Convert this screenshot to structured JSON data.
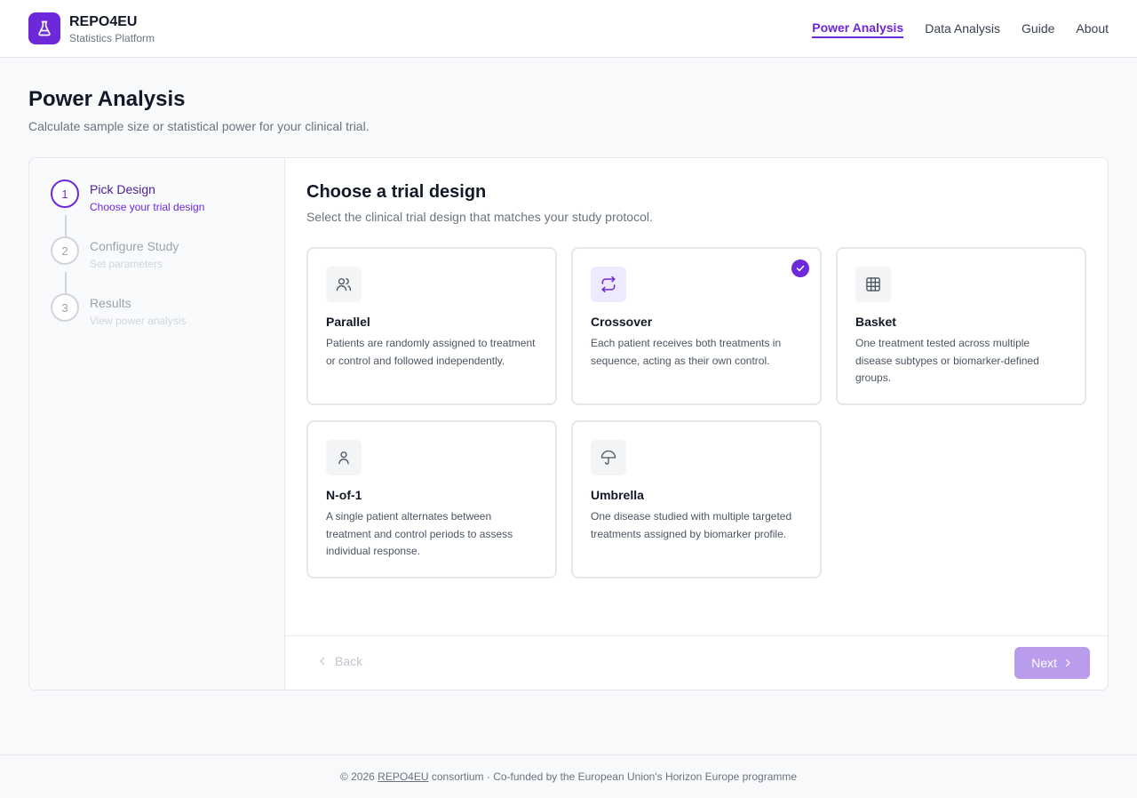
{
  "brand": {
    "name": "REPO4EU",
    "subtitle": "Statistics Platform"
  },
  "nav": [
    {
      "label": "Power Analysis",
      "active": true
    },
    {
      "label": "Data Analysis"
    },
    {
      "label": "Guide"
    },
    {
      "label": "About"
    }
  ],
  "page": {
    "title": "Power Analysis",
    "subtitle": "Calculate sample size or statistical power for your clinical trial."
  },
  "steps": [
    {
      "number": "1",
      "title": "Pick Design",
      "desc": "Choose your trial design",
      "state": "active"
    },
    {
      "number": "2",
      "title": "Configure Study",
      "desc": "Set parameters",
      "state": "pending"
    },
    {
      "number": "3",
      "title": "Results",
      "desc": "View power analysis",
      "state": "pending"
    }
  ],
  "content": {
    "title": "Choose a trial design",
    "subtitle": "Select the clinical trial design that matches your study protocol."
  },
  "designs": [
    {
      "id": "parallel",
      "icon": "users-icon",
      "title": "Parallel",
      "desc": "Patients are randomly assigned to treatment or control and followed independently."
    },
    {
      "id": "crossover",
      "icon": "repeat-icon",
      "title": "Crossover",
      "desc": "Each patient receives both treatments in sequence, acting as their own control.",
      "selected": true
    },
    {
      "id": "basket",
      "icon": "grid-icon",
      "title": "Basket",
      "desc": "One treatment tested across multiple disease subtypes or biomarker-defined groups."
    },
    {
      "id": "n-of-1",
      "icon": "user-icon",
      "title": "N-of-1",
      "desc": "A single patient alternates between treatment and control periods to assess individual response."
    },
    {
      "id": "umbrella",
      "icon": "umbrella-icon",
      "title": "Umbrella",
      "desc": "One disease studied with multiple targeted treatments assigned by biomarker profile."
    }
  ],
  "actions": {
    "back": "Back",
    "next": "Next"
  },
  "footer": {
    "prefix": "© 2026 ",
    "link": "REPO4EU",
    "suffix": " consortium · Co-funded by the European Union's Horizon Europe programme"
  },
  "colors": {
    "accent": "#6d28d9",
    "next_disabled": "#b99cec"
  }
}
